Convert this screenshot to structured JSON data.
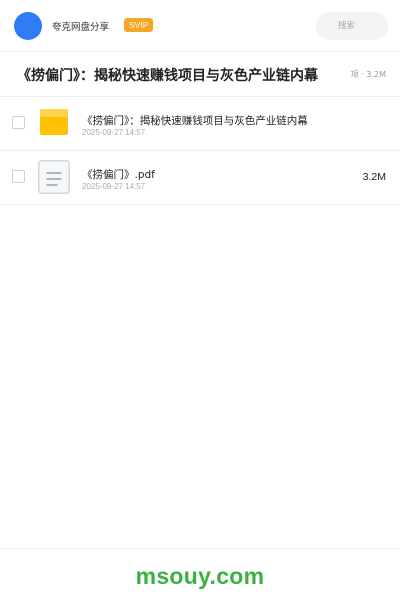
{
  "header": {
    "owner_name": "夸克网盘分享",
    "badge": "SVIP",
    "search_placeholder": "搜索"
  },
  "share": {
    "title": "《捞偏门》：揭秘快速赚钱项目与灰色产业链内幕",
    "meta": "项 · 3.2M"
  },
  "files": [
    {
      "icon": "folder-icon",
      "name": "《捞偏门》：揭秘快速赚钱项目与灰色产业链内幕",
      "date": "2025-09-27 14:57",
      "size": ""
    },
    {
      "icon": "document-icon",
      "name": "《捞偏门》.pdf",
      "date": "2025-09-27 14:57",
      "size": "3.2M"
    }
  ],
  "footer": {
    "watermark": "msouy.com"
  },
  "colors": {
    "avatar": "#2f7cf6",
    "svip_badge": "#f5a623",
    "folder": "#ffc107",
    "watermark": "#3cb043"
  }
}
